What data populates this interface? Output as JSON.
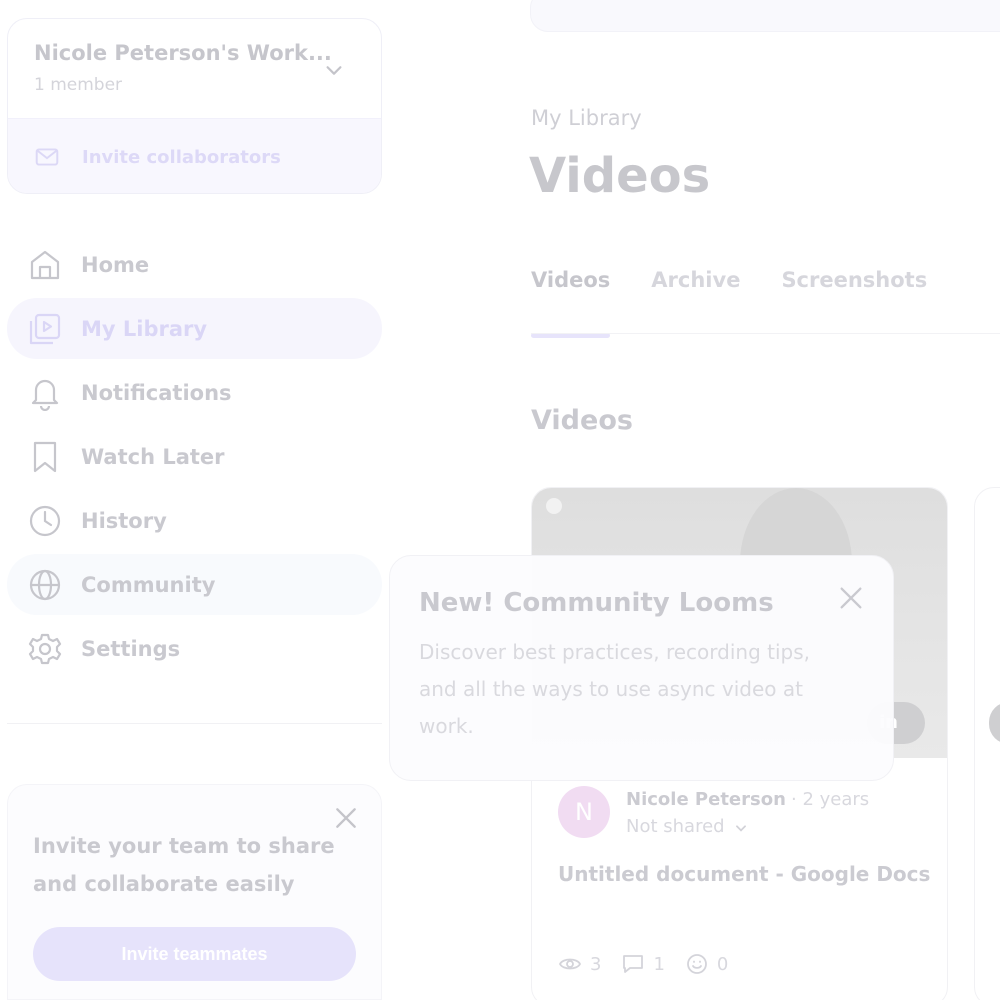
{
  "workspace": {
    "name": "Nicole Peterson's Work...",
    "members": "1 member",
    "invite_label": "Invite collaborators"
  },
  "sidebar": {
    "items": [
      {
        "label": "Home",
        "icon": "home-icon"
      },
      {
        "label": "My Library",
        "icon": "library-icon"
      },
      {
        "label": "Notifications",
        "icon": "bell-icon"
      },
      {
        "label": "Watch Later",
        "icon": "bookmark-icon"
      },
      {
        "label": "History",
        "icon": "clock-icon"
      },
      {
        "label": "Community",
        "icon": "globe-icon"
      },
      {
        "label": "Settings",
        "icon": "gear-icon"
      }
    ],
    "active_item": "My Library"
  },
  "invite_card": {
    "text": "Invite your team to share and collaborate easily",
    "button_label": "Invite teammates"
  },
  "main": {
    "breadcrumb": "My Library",
    "title": "Videos",
    "tabs": [
      {
        "label": "Videos"
      },
      {
        "label": "Archive"
      },
      {
        "label": "Screenshots"
      }
    ],
    "section_title": "Videos"
  },
  "video": {
    "duration_partial": "in",
    "author_initial": "N",
    "author_name": "Nicole Peterson",
    "time_ago": "· 2 years",
    "share_status": "Not shared",
    "title": "Untitled document - Google Docs",
    "views": "3",
    "comments": "1",
    "reactions": "0"
  },
  "popover": {
    "title": "New! Community Looms",
    "body": "Discover best practices, recording tips, and all the ways to use async video at work."
  },
  "colors": {
    "accent": "#e6e3fb",
    "active_bg": "#f6f5fd",
    "avatar_bg": "#f1dcf2"
  }
}
